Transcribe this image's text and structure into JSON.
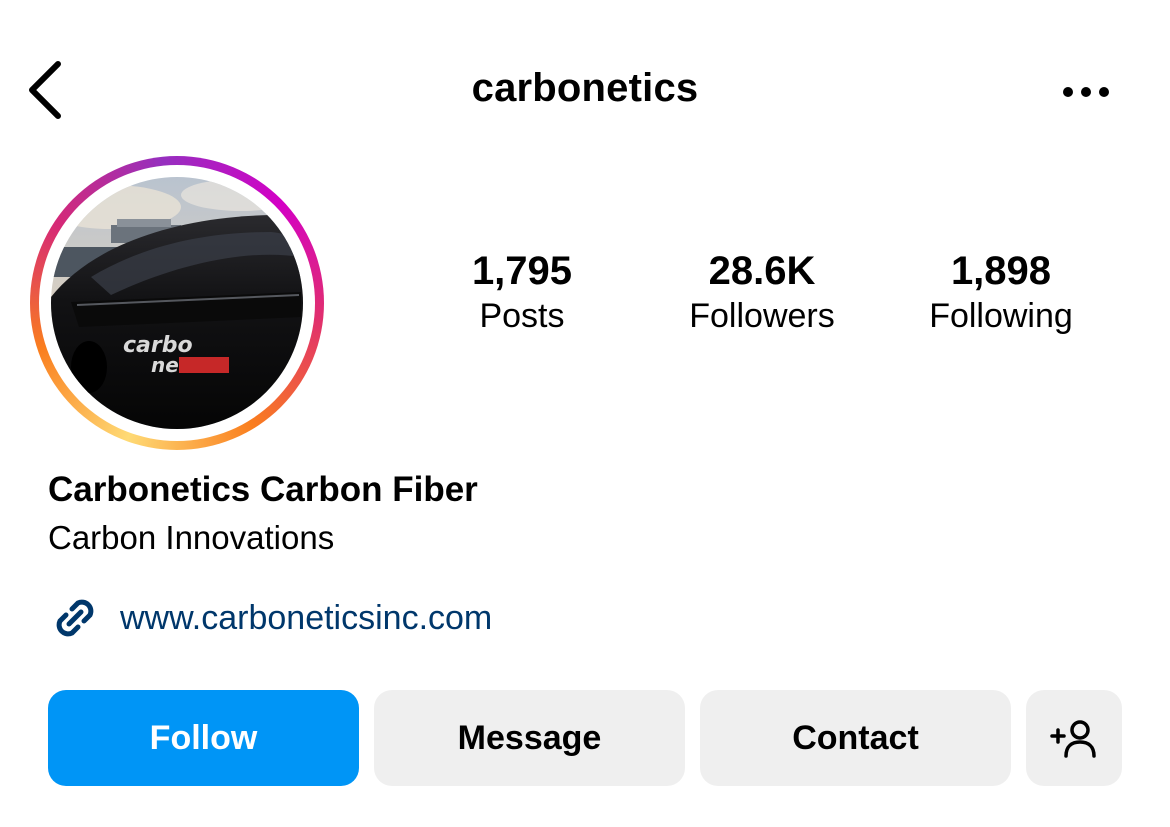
{
  "header": {
    "username": "carbonetics",
    "back_icon": "chevron-left-icon",
    "more_icon": "more-horizontal-icon"
  },
  "profile": {
    "avatar_alt": "carbonetics profile picture",
    "stats": [
      {
        "value": "1,795",
        "label": "Posts"
      },
      {
        "value": "28.6K",
        "label": "Followers"
      },
      {
        "value": "1,898",
        "label": "Following"
      }
    ],
    "display_name": "Carbonetics Carbon Fiber",
    "category": "Carbon Innovations",
    "website": "www.carboneticsinc.com",
    "link_icon": "link-icon"
  },
  "actions": {
    "follow_label": "Follow",
    "message_label": "Message",
    "contact_label": "Contact",
    "add_user_icon": "add-user-icon"
  },
  "colors": {
    "primary_button": "#0095f6",
    "secondary_button": "#efefef",
    "link": "#00376b"
  }
}
